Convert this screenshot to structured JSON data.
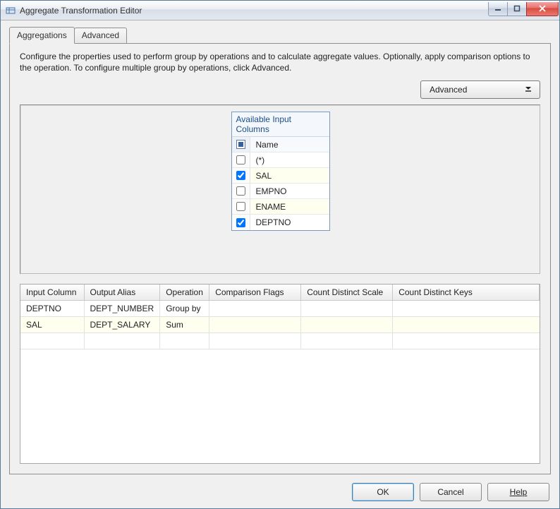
{
  "window": {
    "title": "Aggregate Transformation Editor"
  },
  "tabs": {
    "aggregations": "Aggregations",
    "advanced": "Advanced"
  },
  "description": "Configure the properties used to perform group by operations and to calculate aggregate values. Optionally, apply comparison options to the operation. To configure multiple group by operations, click Advanced.",
  "advanced_button": "Advanced",
  "columns_panel": {
    "title": "Available Input Columns",
    "name_header": "Name",
    "items": [
      {
        "name": "(*)",
        "checked": false,
        "selected": false
      },
      {
        "name": "SAL",
        "checked": true,
        "selected": true
      },
      {
        "name": "EMPNO",
        "checked": false,
        "selected": false
      },
      {
        "name": "ENAME",
        "checked": false,
        "selected": true
      },
      {
        "name": "DEPTNO",
        "checked": true,
        "selected": false
      }
    ]
  },
  "grid": {
    "headers": {
      "input": "Input Column",
      "alias": "Output Alias",
      "operation": "Operation",
      "flags": "Comparison Flags",
      "scale": "Count Distinct Scale",
      "keys": "Count Distinct Keys"
    },
    "rows": [
      {
        "input": "DEPTNO",
        "alias": "DEPT_NUMBER",
        "operation": "Group by",
        "flags": "",
        "scale": "",
        "keys": "",
        "selected": false
      },
      {
        "input": "SAL",
        "alias": "DEPT_SALARY",
        "operation": "Sum",
        "flags": "",
        "scale": "",
        "keys": "",
        "selected": true
      }
    ]
  },
  "buttons": {
    "ok": "OK",
    "cancel": "Cancel",
    "help": "Help"
  }
}
